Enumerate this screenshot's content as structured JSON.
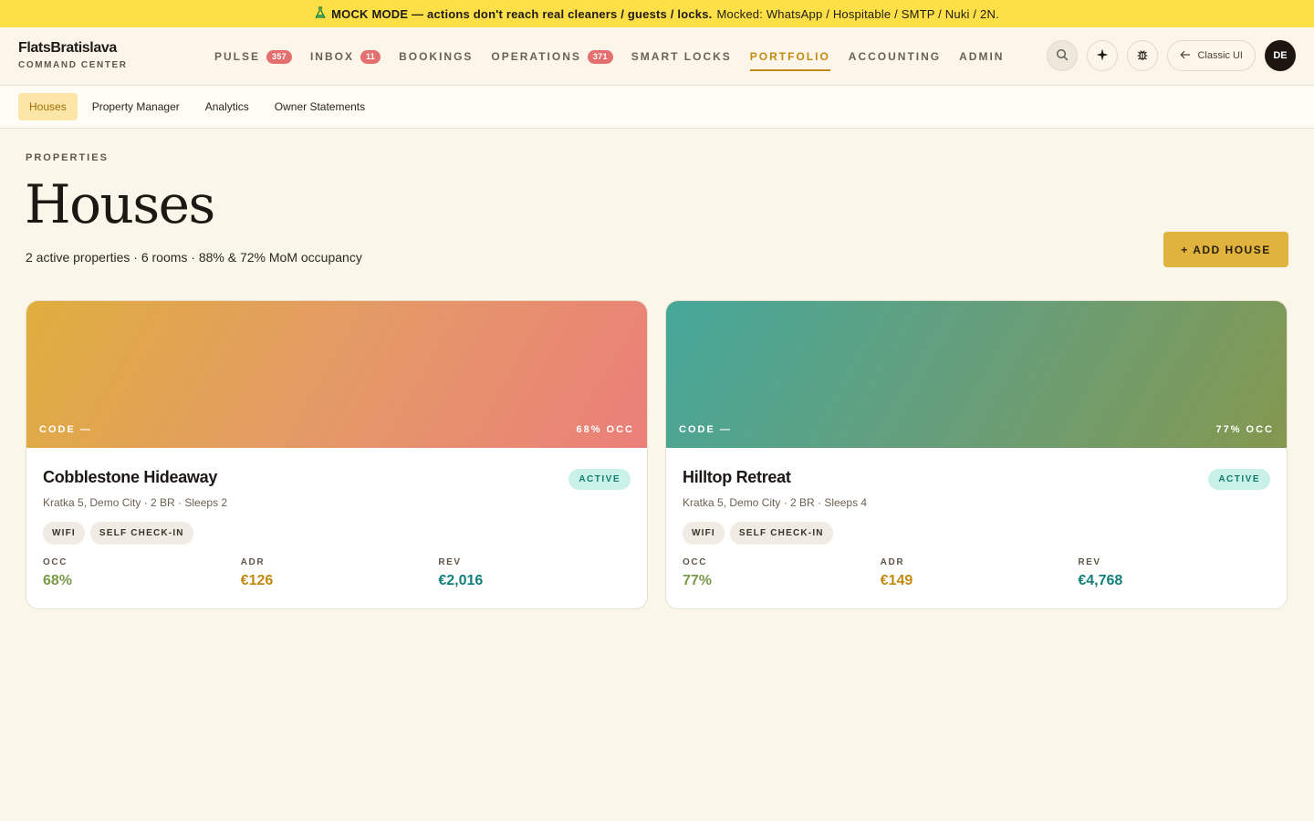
{
  "banner": {
    "icon": "flask-icon",
    "strong_text": "MOCK MODE — actions don't reach real cleaners / guests / locks.",
    "detail_text": "Mocked: WhatsApp / Hospitable / SMTP / Nuki / 2N."
  },
  "brand": {
    "name": "FlatsBratislava",
    "subtitle": "COMMAND CENTER"
  },
  "nav": {
    "items": [
      {
        "label": "PULSE",
        "badge": "357"
      },
      {
        "label": "INBOX",
        "badge": "11"
      },
      {
        "label": "BOOKINGS",
        "badge": ""
      },
      {
        "label": "OPERATIONS",
        "badge": "371"
      },
      {
        "label": "SMART LOCKS",
        "badge": ""
      },
      {
        "label": "PORTFOLIO",
        "badge": "",
        "active": true
      },
      {
        "label": "ACCOUNTING",
        "badge": ""
      },
      {
        "label": "ADMIN",
        "badge": ""
      }
    ],
    "active_color": "#c28a11",
    "badge_color": "#e36f6f"
  },
  "actions": {
    "search_icon": "search-icon",
    "sparkle_icon": "sparkle-icon",
    "bug_icon": "bug-icon",
    "classic_label": "Classic UI",
    "avatar_initials": "DE"
  },
  "subnav": {
    "items": [
      "Houses",
      "Property Manager",
      "Analytics",
      "Owner Statements"
    ],
    "active": "Houses"
  },
  "header": {
    "eyebrow": "PROPERTIES",
    "title": "Houses",
    "subtitle": "2 active properties · 6 rooms · 88% & 72% MoM occupancy",
    "add_button": "+ ADD HOUSE",
    "add_button_color": "#dfb33e"
  },
  "cards": [
    {
      "code": "CODE —",
      "occ_overlay": "68% OCC",
      "name": "Cobblestone Hideaway",
      "status": "ACTIVE",
      "meta": "Kratka 5, Demo City · 2 BR · Sleeps 2",
      "tags": [
        "WIFI",
        "SELF CHECK-IN"
      ],
      "stats": {
        "occ_label": "OCC",
        "occ": "68%",
        "adr_label": "ADR",
        "adr": "€126",
        "rev_label": "REV",
        "rev": "€2,016"
      },
      "gradient": [
        "#dfae3e",
        "#eb7f7a"
      ]
    },
    {
      "code": "CODE —",
      "occ_overlay": "77% OCC",
      "name": "Hilltop Retreat",
      "status": "ACTIVE",
      "meta": "Kratka 5, Demo City · 2 BR · Sleeps 4",
      "tags": [
        "WIFI",
        "SELF CHECK-IN"
      ],
      "stats": {
        "occ_label": "OCC",
        "occ": "77%",
        "adr_label": "ADR",
        "adr": "€149",
        "rev_label": "REV",
        "rev": "€4,768"
      },
      "gradient": [
        "#46a89a",
        "#84984f"
      ]
    }
  ],
  "stat_colors": {
    "occ": "#7a9a4a",
    "adr": "#c28a11",
    "rev": "#12807a"
  }
}
